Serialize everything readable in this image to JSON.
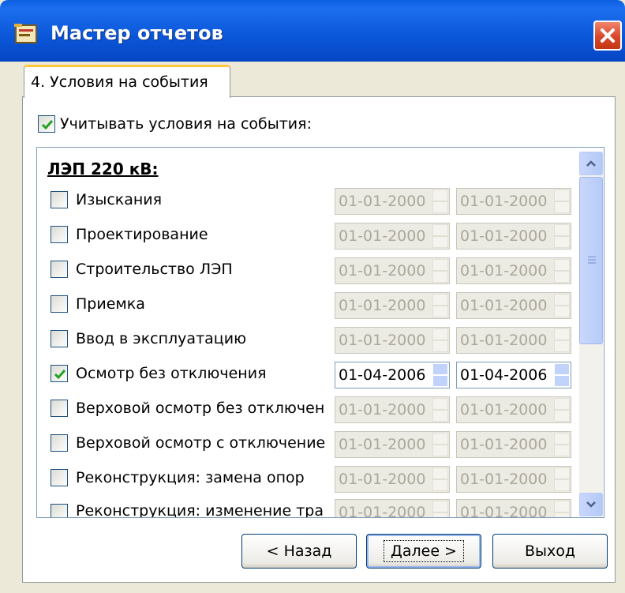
{
  "window": {
    "title": "Мастер отчетов"
  },
  "tab": {
    "label": "4. Условия на события"
  },
  "use_conditions": {
    "label": "Учитывать условия на события:",
    "checked": true
  },
  "section": {
    "title": "ЛЭП 220 кВ:"
  },
  "events": [
    {
      "label": "Изыскания",
      "checked": false,
      "start": "01-01-2000",
      "end": "01-01-2000",
      "enabled": false
    },
    {
      "label": "Проектирование",
      "checked": false,
      "start": "01-01-2000",
      "end": "01-01-2000",
      "enabled": false
    },
    {
      "label": "Строительство ЛЭП",
      "checked": false,
      "start": "01-01-2000",
      "end": "01-01-2000",
      "enabled": false
    },
    {
      "label": "Приемка",
      "checked": false,
      "start": "01-01-2000",
      "end": "01-01-2000",
      "enabled": false
    },
    {
      "label": "Ввод в эксплуатацию",
      "checked": false,
      "start": "01-01-2000",
      "end": "01-01-2000",
      "enabled": false
    },
    {
      "label": "Осмотр без отключения",
      "checked": true,
      "start": "01-04-2006",
      "end": "01-04-2006",
      "enabled": true
    },
    {
      "label": "Верховой осмотр без отключен",
      "checked": false,
      "start": "01-01-2000",
      "end": "01-01-2000",
      "enabled": false
    },
    {
      "label": "Верховой осмотр с отключение",
      "checked": false,
      "start": "01-01-2000",
      "end": "01-01-2000",
      "enabled": false
    },
    {
      "label": "Реконструкция: замена опор",
      "checked": false,
      "start": "01-01-2000",
      "end": "01-01-2000",
      "enabled": false
    },
    {
      "label": "Реконструкция: изменение тра",
      "checked": false,
      "start": "01-01-2000",
      "end": "01-01-2000",
      "enabled": false
    }
  ],
  "buttons": {
    "back": "< Назад",
    "next": "Далее >",
    "exit": "Выход"
  },
  "colors": {
    "titlebar": "#0a56d8",
    "close": "#d9472b",
    "check": "#21a121",
    "tab_highlight": "#ffc83c"
  },
  "icons": {
    "app": "report-wizard-icon",
    "close": "close-icon",
    "scroll_up": "chevron-up-icon",
    "scroll_down": "chevron-down-icon"
  }
}
